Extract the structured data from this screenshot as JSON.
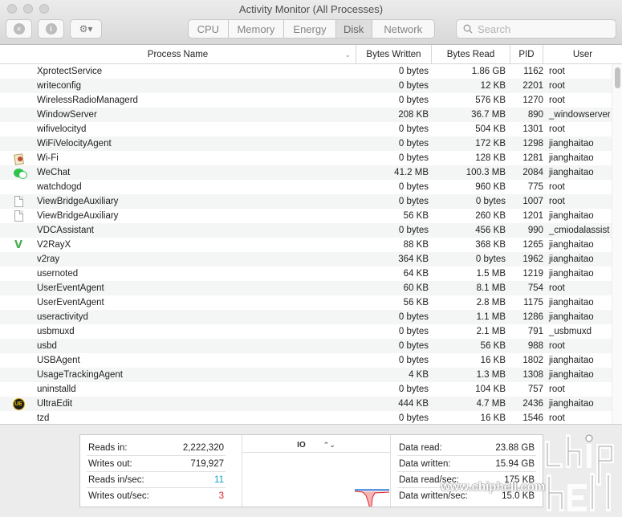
{
  "window": {
    "title": "Activity Monitor (All Processes)"
  },
  "toolbar": {
    "close_glyph": "✕",
    "info_glyph": "i",
    "gear_glyph": "⚙▾",
    "tabs": [
      {
        "label": "CPU",
        "active": false
      },
      {
        "label": "Memory",
        "active": false
      },
      {
        "label": "Energy",
        "active": false
      },
      {
        "label": "Disk",
        "active": true
      },
      {
        "label": "Network",
        "active": false
      }
    ],
    "search_placeholder": "Search"
  },
  "table": {
    "columns": {
      "name": "Process Name",
      "bytes_written": "Bytes Written",
      "bytes_read": "Bytes Read",
      "pid": "PID",
      "user": "User"
    },
    "rows": [
      {
        "icon": "",
        "name": "XprotectService",
        "bytes_written": "0 bytes",
        "bytes_read": "1.86 GB",
        "pid": "1162",
        "user": "root"
      },
      {
        "icon": "",
        "name": "writeconfig",
        "bytes_written": "0 bytes",
        "bytes_read": "12 KB",
        "pid": "2201",
        "user": "root"
      },
      {
        "icon": "",
        "name": "WirelessRadioManagerd",
        "bytes_written": "0 bytes",
        "bytes_read": "576 KB",
        "pid": "1270",
        "user": "root"
      },
      {
        "icon": "",
        "name": "WindowServer",
        "bytes_written": "208 KB",
        "bytes_read": "36.7 MB",
        "pid": "890",
        "user": "_windowserver"
      },
      {
        "icon": "",
        "name": "wifivelocityd",
        "bytes_written": "0 bytes",
        "bytes_read": "504 KB",
        "pid": "1301",
        "user": "root"
      },
      {
        "icon": "",
        "name": "WiFiVelocityAgent",
        "bytes_written": "0 bytes",
        "bytes_read": "172 KB",
        "pid": "1298",
        "user": "jianghaitao"
      },
      {
        "icon": "wifi",
        "name": "Wi-Fi",
        "bytes_written": "0 bytes",
        "bytes_read": "128 KB",
        "pid": "1281",
        "user": "jianghaitao"
      },
      {
        "icon": "wechat",
        "name": "WeChat",
        "bytes_written": "41.2 MB",
        "bytes_read": "100.3 MB",
        "pid": "2084",
        "user": "jianghaitao"
      },
      {
        "icon": "",
        "name": "watchdogd",
        "bytes_written": "0 bytes",
        "bytes_read": "960 KB",
        "pid": "775",
        "user": "root"
      },
      {
        "icon": "doc",
        "name": "ViewBridgeAuxiliary",
        "bytes_written": "0 bytes",
        "bytes_read": "0 bytes",
        "pid": "1007",
        "user": "root"
      },
      {
        "icon": "doc",
        "name": "ViewBridgeAuxiliary",
        "bytes_written": "56 KB",
        "bytes_read": "260 KB",
        "pid": "1201",
        "user": "jianghaitao"
      },
      {
        "icon": "",
        "name": "VDCAssistant",
        "bytes_written": "0 bytes",
        "bytes_read": "456 KB",
        "pid": "990",
        "user": "_cmiodalassist"
      },
      {
        "icon": "v2ray",
        "name": "V2RayX",
        "bytes_written": "88 KB",
        "bytes_read": "368 KB",
        "pid": "1265",
        "user": "jianghaitao"
      },
      {
        "icon": "",
        "name": "v2ray",
        "bytes_written": "364 KB",
        "bytes_read": "0 bytes",
        "pid": "1962",
        "user": "jianghaitao"
      },
      {
        "icon": "",
        "name": "usernoted",
        "bytes_written": "64 KB",
        "bytes_read": "1.5 MB",
        "pid": "1219",
        "user": "jianghaitao"
      },
      {
        "icon": "",
        "name": "UserEventAgent",
        "bytes_written": "60 KB",
        "bytes_read": "8.1 MB",
        "pid": "754",
        "user": "root"
      },
      {
        "icon": "",
        "name": "UserEventAgent",
        "bytes_written": "56 KB",
        "bytes_read": "2.8 MB",
        "pid": "1175",
        "user": "jianghaitao"
      },
      {
        "icon": "",
        "name": "useractivityd",
        "bytes_written": "0 bytes",
        "bytes_read": "1.1 MB",
        "pid": "1286",
        "user": "jianghaitao"
      },
      {
        "icon": "",
        "name": "usbmuxd",
        "bytes_written": "0 bytes",
        "bytes_read": "2.1 MB",
        "pid": "791",
        "user": "_usbmuxd"
      },
      {
        "icon": "",
        "name": "usbd",
        "bytes_written": "0 bytes",
        "bytes_read": "56 KB",
        "pid": "988",
        "user": "root"
      },
      {
        "icon": "",
        "name": "USBAgent",
        "bytes_written": "0 bytes",
        "bytes_read": "16 KB",
        "pid": "1802",
        "user": "jianghaitao"
      },
      {
        "icon": "",
        "name": "UsageTrackingAgent",
        "bytes_written": "4 KB",
        "bytes_read": "1.3 MB",
        "pid": "1308",
        "user": "jianghaitao"
      },
      {
        "icon": "",
        "name": "uninstalld",
        "bytes_written": "0 bytes",
        "bytes_read": "104 KB",
        "pid": "757",
        "user": "root"
      },
      {
        "icon": "ultraedit",
        "name": "UltraEdit",
        "bytes_written": "444 KB",
        "bytes_read": "4.7 MB",
        "pid": "2436",
        "user": "jianghaitao"
      },
      {
        "icon": "",
        "name": "tzd",
        "bytes_written": "0 bytes",
        "bytes_read": "16 KB",
        "pid": "1546",
        "user": "root"
      }
    ]
  },
  "stats": {
    "left": [
      {
        "label": "Reads in:",
        "value": "2,222,320",
        "tone": "normal"
      },
      {
        "label": "Writes out:",
        "value": "719,927",
        "tone": "normal"
      },
      {
        "label": "Reads in/sec:",
        "value": "11",
        "tone": "cyan"
      },
      {
        "label": "Writes out/sec:",
        "value": "3",
        "tone": "red"
      }
    ],
    "graph_selector": "IO",
    "graph_selector_arrows": "⌃⌄",
    "right": [
      {
        "label": "Data read:",
        "value": "23.88 GB",
        "tone": "normal"
      },
      {
        "label": "Data written:",
        "value": "15.94 GB",
        "tone": "normal"
      },
      {
        "label": "Data read/sec:",
        "value": "175 KB",
        "tone": "normal"
      },
      {
        "label": "Data written/sec:",
        "value": "15.0 KB",
        "tone": "normal"
      }
    ]
  },
  "watermark": {
    "url": "www.chiphell.com",
    "logo_text": "chiphell"
  },
  "colors": {
    "reads_color": "#14a0c8",
    "writes_color": "#e0202a"
  }
}
